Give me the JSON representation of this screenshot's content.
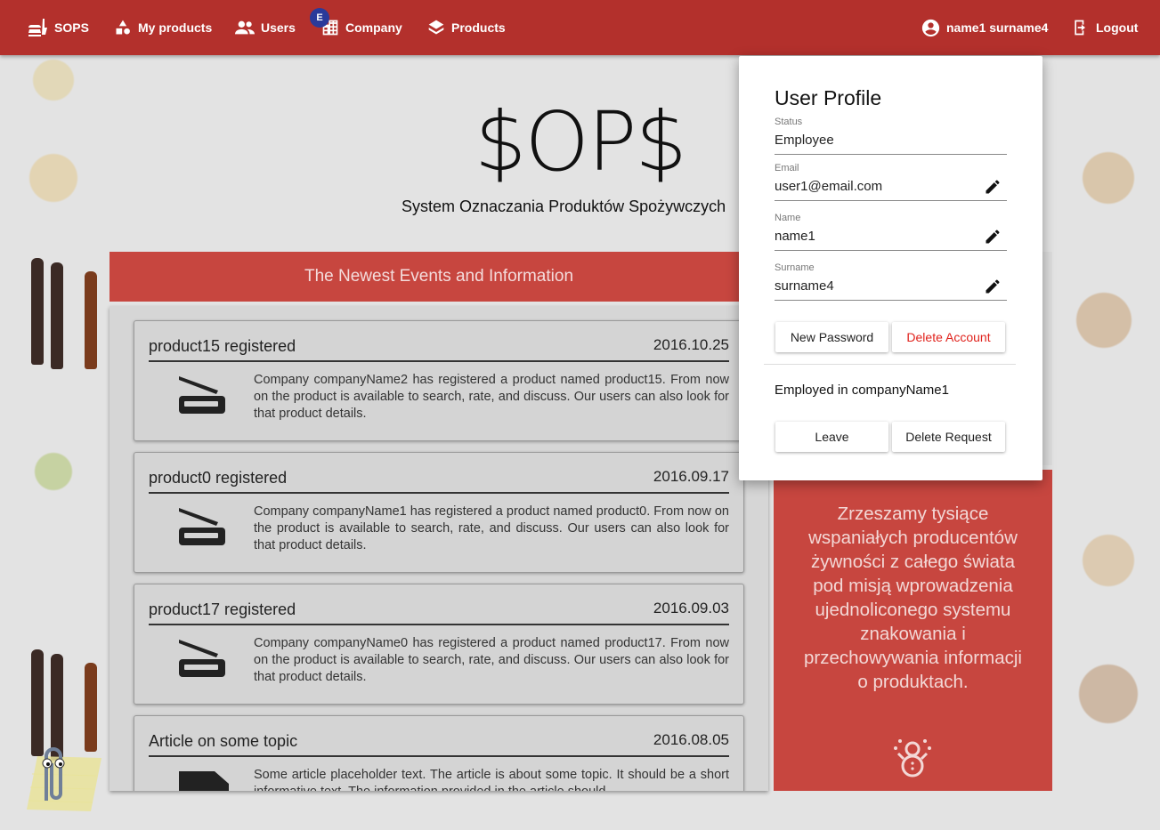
{
  "nav": {
    "brand": "SOPS",
    "my_products": "My products",
    "users": "Users",
    "company": "Company",
    "company_badge": "E",
    "products": "Products",
    "user": "name1 surname4",
    "logout": "Logout"
  },
  "hero": {
    "title": "$OP$",
    "subtitle": "System Oznaczania Produktów Spożywczych"
  },
  "events": {
    "header": "The Newest Events and Information",
    "items": [
      {
        "title": "product15 registered",
        "date": "2016.10.25",
        "icon": "barcode-scanner-icon",
        "text": "Company companyName2 has registered a product named product15. From now on the product is available to search, rate, and discuss. Our users can also look for that product details."
      },
      {
        "title": "product0 registered",
        "date": "2016.09.17",
        "icon": "barcode-scanner-icon",
        "text": "Company companyName1 has registered a product named product0. From now on the product is available to search, rate, and discuss. Our users can also look for that product details."
      },
      {
        "title": "product17 registered",
        "date": "2016.09.03",
        "icon": "barcode-scanner-icon",
        "text": "Company companyName0 has registered a product named product17. From now on the product is available to search, rate, and discuss. Our users can also look for that product details."
      },
      {
        "title": "Article on some topic",
        "date": "2016.08.05",
        "icon": "article-icon",
        "text": "Some article placeholder text. The article is about some topic. It should be a short informative text. The information provided in the article should"
      }
    ]
  },
  "promo": {
    "text": "Zrzeszamy tysiące wspaniałych producentów żywności z całego świata pod misją wprowadzenia ujednoliconego systemu znakowania i przechowywania informacji o produktach."
  },
  "profile": {
    "title": "User Profile",
    "status_label": "Status",
    "status_value": "Employee",
    "email_label": "Email",
    "email_value": "user1@email.com",
    "name_label": "Name",
    "name_value": "name1",
    "surname_label": "Surname",
    "surname_value": "surname4",
    "new_password": "New Password",
    "delete_account": "Delete Account",
    "employed_in": "Employed in companyName1",
    "leave": "Leave",
    "delete_request": "Delete Request"
  },
  "colors": {
    "topbar": "#b3302c",
    "accent": "#c7463f",
    "danger": "#e0221c",
    "badge": "#2a3a9a"
  }
}
